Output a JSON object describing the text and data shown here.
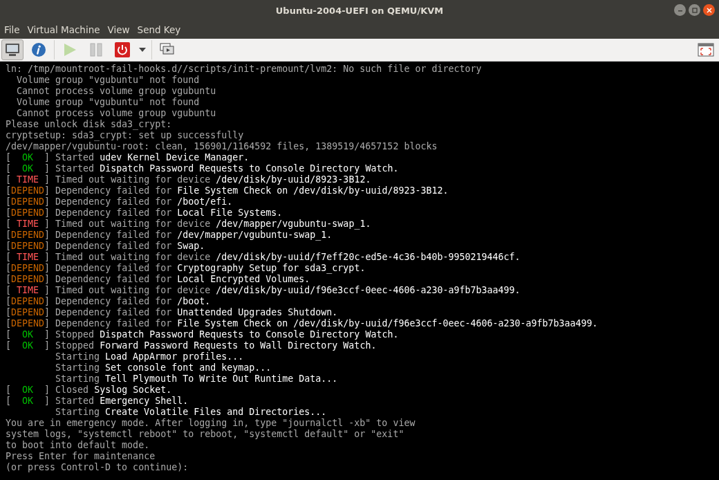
{
  "window": {
    "title": "Ubuntu-2004-UEFI on QEMU/KVM"
  },
  "menu": [
    "File",
    "Virtual Machine",
    "View",
    "Send Key"
  ],
  "toolbar": [
    {
      "kind": "console",
      "selected": true,
      "disabled": false
    },
    {
      "kind": "details",
      "selected": false,
      "disabled": false
    },
    {
      "kind": "run",
      "selected": false,
      "disabled": true
    },
    {
      "kind": "pause",
      "selected": false,
      "disabled": true
    },
    {
      "kind": "shutdown",
      "selected": false,
      "disabled": false
    },
    {
      "kind": "dropdown",
      "selected": false,
      "disabled": false
    },
    {
      "kind": "snapshots",
      "selected": false,
      "disabled": false
    },
    {
      "kind": "fullscreen",
      "selected": false,
      "disabled": false
    }
  ],
  "console": [
    {
      "kind": "plain",
      "text": "ln: /tmp/mountroot-fail-hooks.d//scripts/init-premount/lvm2: No such file or directory"
    },
    {
      "kind": "plain",
      "text": "  Volume group \"vgubuntu\" not found"
    },
    {
      "kind": "plain",
      "text": "  Cannot process volume group vgubuntu"
    },
    {
      "kind": "plain",
      "text": "  Volume group \"vgubuntu\" not found"
    },
    {
      "kind": "plain",
      "text": "  Cannot process volume group vgubuntu"
    },
    {
      "kind": "plain",
      "text": "Please unlock disk sda3_crypt:"
    },
    {
      "kind": "plain",
      "text": "cryptsetup: sda3_crypt: set up successfully"
    },
    {
      "kind": "plain",
      "text": "/dev/mapper/vgubuntu-root: clean, 156901/1164592 files, 1389519/4657152 blocks"
    },
    {
      "kind": "status",
      "color": "#00c000",
      "left": "[  ",
      "label": "OK",
      "right": "  ]",
      "verb": "Started",
      "object": "udev Kernel Device Manager."
    },
    {
      "kind": "status",
      "color": "#00c000",
      "left": "[  ",
      "label": "OK",
      "right": "  ]",
      "verb": "Started",
      "object": "Dispatch Password Requests to Console Directory Watch."
    },
    {
      "kind": "status",
      "color": "#ff5555",
      "left": "[ ",
      "label": "TIME",
      "right": " ]",
      "verb": "Timed out waiting for device",
      "object": "/dev/disk/by-uuid/8923-3B12."
    },
    {
      "kind": "status",
      "color": "#c86400",
      "left": "[",
      "label": "DEPEND",
      "right": "]",
      "verb": "Dependency failed for",
      "object": "File System Check on /dev/disk/by-uuid/8923-3B12."
    },
    {
      "kind": "status",
      "color": "#c86400",
      "left": "[",
      "label": "DEPEND",
      "right": "]",
      "verb": "Dependency failed for",
      "object": "/boot/efi."
    },
    {
      "kind": "status",
      "color": "#c86400",
      "left": "[",
      "label": "DEPEND",
      "right": "]",
      "verb": "Dependency failed for",
      "object": "Local File Systems."
    },
    {
      "kind": "status",
      "color": "#ff5555",
      "left": "[ ",
      "label": "TIME",
      "right": " ]",
      "verb": "Timed out waiting for device",
      "object": "/dev/mapper/vgubuntu-swap_1."
    },
    {
      "kind": "status",
      "color": "#c86400",
      "left": "[",
      "label": "DEPEND",
      "right": "]",
      "verb": "Dependency failed for",
      "object": "/dev/mapper/vgubuntu-swap_1."
    },
    {
      "kind": "status",
      "color": "#c86400",
      "left": "[",
      "label": "DEPEND",
      "right": "]",
      "verb": "Dependency failed for",
      "object": "Swap."
    },
    {
      "kind": "status",
      "color": "#ff5555",
      "left": "[ ",
      "label": "TIME",
      "right": " ]",
      "verb": "Timed out waiting for device",
      "object": "/dev/disk/by-uuid/f7eff20c-ed5e-4c36-b40b-9950219446cf."
    },
    {
      "kind": "status",
      "color": "#c86400",
      "left": "[",
      "label": "DEPEND",
      "right": "]",
      "verb": "Dependency failed for",
      "object": "Cryptography Setup for sda3_crypt."
    },
    {
      "kind": "status",
      "color": "#c86400",
      "left": "[",
      "label": "DEPEND",
      "right": "]",
      "verb": "Dependency failed for",
      "object": "Local Encrypted Volumes."
    },
    {
      "kind": "status",
      "color": "#ff5555",
      "left": "[ ",
      "label": "TIME",
      "right": " ]",
      "verb": "Timed out waiting for device",
      "object": "/dev/disk/by-uuid/f96e3ccf-0eec-4606-a230-a9fb7b3aa499."
    },
    {
      "kind": "status",
      "color": "#c86400",
      "left": "[",
      "label": "DEPEND",
      "right": "]",
      "verb": "Dependency failed for",
      "object": "/boot."
    },
    {
      "kind": "status",
      "color": "#c86400",
      "left": "[",
      "label": "DEPEND",
      "right": "]",
      "verb": "Dependency failed for",
      "object": "Unattended Upgrades Shutdown."
    },
    {
      "kind": "status",
      "color": "#c86400",
      "left": "[",
      "label": "DEPEND",
      "right": "]",
      "verb": "Dependency failed for",
      "object": "File System Check on /dev/disk/by-uuid/f96e3ccf-0eec-4606-a230-a9fb7b3aa499."
    },
    {
      "kind": "status",
      "color": "#00c000",
      "left": "[  ",
      "label": "OK",
      "right": "  ]",
      "verb": "Stopped",
      "object": "Dispatch Password Requests to Console Directory Watch."
    },
    {
      "kind": "status",
      "color": "#00c000",
      "left": "[  ",
      "label": "OK",
      "right": "  ]",
      "verb": "Stopped",
      "object": "Forward Password Requests to Wall Directory Watch."
    },
    {
      "kind": "starting",
      "verb": "Starting",
      "object": "Load AppArmor profiles..."
    },
    {
      "kind": "starting",
      "verb": "Starting",
      "object": "Set console font and keymap..."
    },
    {
      "kind": "starting",
      "verb": "Starting",
      "object": "Tell Plymouth To Write Out Runtime Data..."
    },
    {
      "kind": "status",
      "color": "#00c000",
      "left": "[  ",
      "label": "OK",
      "right": "  ]",
      "verb": "Closed",
      "object": "Syslog Socket."
    },
    {
      "kind": "status",
      "color": "#00c000",
      "left": "[  ",
      "label": "OK",
      "right": "  ]",
      "verb": "Started",
      "object": "Emergency Shell."
    },
    {
      "kind": "starting",
      "verb": "Starting",
      "object": "Create Volatile Files and Directories..."
    },
    {
      "kind": "plain",
      "text": "You are in emergency mode. After logging in, type \"journalctl -xb\" to view"
    },
    {
      "kind": "plain",
      "text": "system logs, \"systemctl reboot\" to reboot, \"systemctl default\" or \"exit\""
    },
    {
      "kind": "plain",
      "text": "to boot into default mode."
    },
    {
      "kind": "plain",
      "text": "Press Enter for maintenance"
    },
    {
      "kind": "plain",
      "text": "(or press Control-D to continue):"
    }
  ]
}
